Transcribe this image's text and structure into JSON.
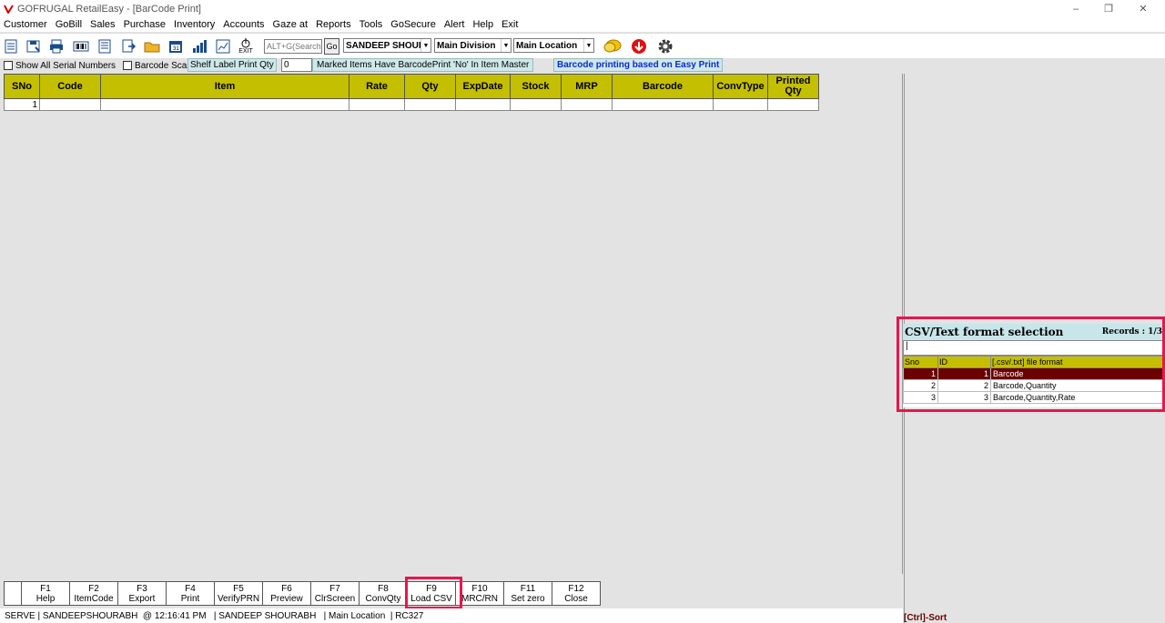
{
  "window": {
    "title": "GOFRUGAL RetailEasy - [BarCode Print]",
    "controls": [
      "–",
      "❐",
      "✕"
    ]
  },
  "menu": [
    "Customer",
    "GoBill",
    "Sales",
    "Purchase",
    "Inventory",
    "Accounts",
    "Gaze at",
    "Reports",
    "Tools",
    "GoSecure",
    "Alert",
    "Help",
    "Exit"
  ],
  "toolbar": {
    "search_placeholder": "ALT+G(Search",
    "go_label": "Go",
    "user_combo": "SANDEEP SHOURA",
    "division_combo": "Main Division",
    "location_combo": "Main Location",
    "exit_label": "EXIT"
  },
  "options": {
    "show_serial": "Show All Serial Numbers",
    "barcode_scanning": "Barcode Scaning",
    "shelf_label": "Shelf Label Print Qty",
    "shelf_qty": "0",
    "marked_items": "Marked Items Have BarcodePrint 'No' In Item Master",
    "easy_print": "Barcode printing based on Easy Print"
  },
  "grid": {
    "columns": [
      "SNo",
      "Code",
      "Item",
      "Rate",
      "Qty",
      "ExpDate",
      "Stock",
      "MRP",
      "Barcode",
      "ConvType",
      "Printed Qty"
    ],
    "rows": [
      [
        "1",
        "",
        "",
        "",
        "",
        "",
        "",
        "",
        "",
        "",
        ""
      ]
    ]
  },
  "fkeys": [
    {
      "key": "F1",
      "label": "Help"
    },
    {
      "key": "F2",
      "label": "ItemCode"
    },
    {
      "key": "F3",
      "label": "Export"
    },
    {
      "key": "F4",
      "label": "Print"
    },
    {
      "key": "F5",
      "label": "VerifyPRN"
    },
    {
      "key": "F6",
      "label": "Preview"
    },
    {
      "key": "F7",
      "label": "ClrScreen"
    },
    {
      "key": "F8",
      "label": "ConvQty"
    },
    {
      "key": "F9",
      "label": "Load CSV"
    },
    {
      "key": "F10",
      "label": "MRC/RN"
    },
    {
      "key": "F11",
      "label": "Set zero"
    },
    {
      "key": "F12",
      "label": "Close"
    }
  ],
  "status": {
    "text": "SERVE | SANDEEPSHOURABH  @ 12:16:41 PM   | SANDEEP SHOURABH   | Main Location  | RC327"
  },
  "csv_popup": {
    "title": "CSV/Text format selection",
    "records": "Records : 1/3",
    "columns": [
      "Sno",
      "ID",
      "[.csv/.txt] file format"
    ],
    "rows": [
      [
        "1",
        "1",
        "Barcode"
      ],
      [
        "2",
        "2",
        "Barcode,Quantity"
      ],
      [
        "3",
        "3",
        "Barcode,Quantity,Rate"
      ]
    ],
    "footer": "[Ctrl]-Sort"
  },
  "colors": {
    "header_olive": "#c4bf00",
    "highlight_red": "#e8164d",
    "selected_row": "#6b0000",
    "panel_cyan": "#c8e6ea"
  }
}
